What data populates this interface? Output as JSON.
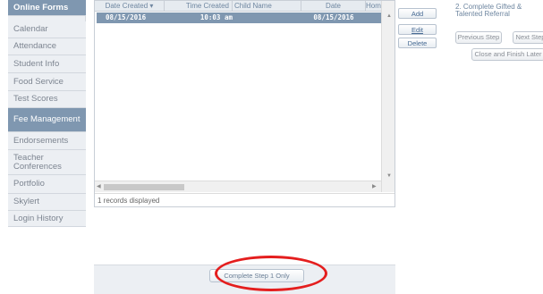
{
  "nav": {
    "items": [
      {
        "label": "Online Forms",
        "state": "first"
      },
      {
        "label": "Calendar",
        "state": ""
      },
      {
        "label": "Attendance",
        "state": ""
      },
      {
        "label": "Student Info",
        "state": ""
      },
      {
        "label": "Food Service",
        "state": ""
      },
      {
        "label": "Test Scores",
        "state": ""
      },
      {
        "label": "Fee Management",
        "state": "active"
      },
      {
        "label": "Endorsements",
        "state": ""
      },
      {
        "label": "Teacher Conferences",
        "state": ""
      },
      {
        "label": "Portfolio",
        "state": ""
      },
      {
        "label": "Skylert",
        "state": ""
      },
      {
        "label": "Login History",
        "state": ""
      }
    ]
  },
  "grid": {
    "columns": [
      "Date Created ▾",
      "Time Created",
      "Child Name",
      "Date",
      "Homer"
    ],
    "rows": [
      [
        "08/15/2016",
        "10:03 am",
        "",
        "08/15/2016",
        ""
      ]
    ],
    "status": "1 records displayed"
  },
  "actions": {
    "add": "Add",
    "edit": "Edit",
    "delete": "Delete"
  },
  "right_panel": {
    "title": "2. Complete Gifted & Talented Referral",
    "previous": "Previous Step",
    "next": "Next Step",
    "close": "Close and Finish Later"
  },
  "bottom": {
    "complete_label": "Complete Step 1 Only"
  },
  "colors": {
    "highlight": "#e41e1e",
    "selected_row": "#7f97b0"
  }
}
